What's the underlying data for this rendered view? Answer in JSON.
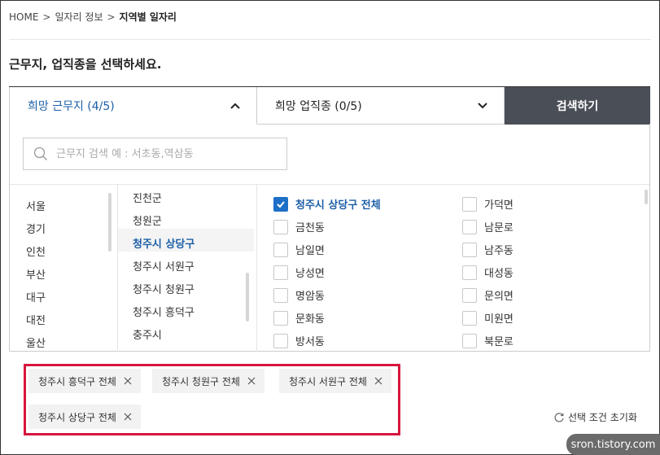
{
  "breadcrumb": {
    "home": "HOME",
    "sep": ">",
    "level1": "일자리 정보",
    "current": "지역별 일자리"
  },
  "page_title": "근무지, 업직종을 선택하세요.",
  "tabs": {
    "location": "희망 근무지 (4/5)",
    "job": "희망 업직종 (0/5)",
    "search_button": "검색하기"
  },
  "search": {
    "placeholder": "근무지 검색 예 : 서초동,역삼동",
    "value": "",
    "icon": "search-icon"
  },
  "regions": [
    "서울",
    "경기",
    "인천",
    "부산",
    "대구",
    "대전",
    "울산"
  ],
  "districts": [
    {
      "label": "진천군",
      "active": false
    },
    {
      "label": "청원군",
      "active": false
    },
    {
      "label": "청주시 상당구",
      "active": true
    },
    {
      "label": "청주시 서원구",
      "active": false
    },
    {
      "label": "청주시 청원구",
      "active": false
    },
    {
      "label": "청주시 흥덕구",
      "active": false
    },
    {
      "label": "충주시",
      "active": false
    }
  ],
  "neighborhoods": {
    "left": [
      {
        "label": "청주시 상당구 전체",
        "checked": true
      },
      {
        "label": "금천동",
        "checked": false
      },
      {
        "label": "남일면",
        "checked": false
      },
      {
        "label": "낭성면",
        "checked": false
      },
      {
        "label": "명암동",
        "checked": false
      },
      {
        "label": "문화동",
        "checked": false
      },
      {
        "label": "방서동",
        "checked": false
      }
    ],
    "right": [
      {
        "label": "가덕면",
        "checked": false
      },
      {
        "label": "남문로",
        "checked": false
      },
      {
        "label": "남주동",
        "checked": false
      },
      {
        "label": "대성동",
        "checked": false
      },
      {
        "label": "문의면",
        "checked": false
      },
      {
        "label": "미원면",
        "checked": false
      },
      {
        "label": "북문로",
        "checked": false
      }
    ]
  },
  "selected_chips": [
    "청주시 흥덕구 전체",
    "청주시 청원구 전체",
    "청주시 서원구 전체",
    "청주시 상당구 전체"
  ],
  "reset_label": "선택 조건 초기화",
  "watermark": "sron.tistory.com",
  "colors": {
    "accent": "#1d5fa8",
    "checkbox": "#1d6fc7",
    "search_button_bg": "#4a4f57",
    "highlight_border": "#d6163e"
  }
}
